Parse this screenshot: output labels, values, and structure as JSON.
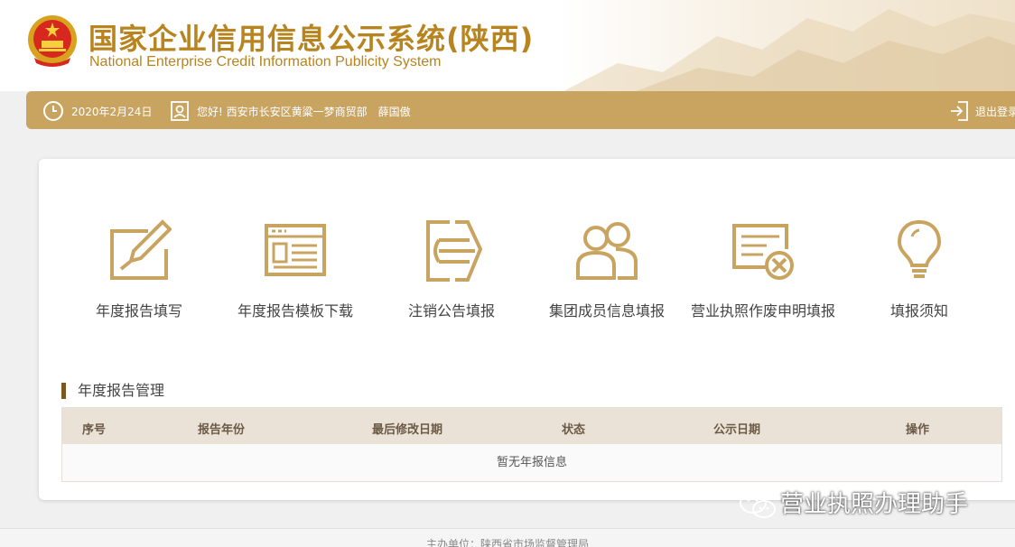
{
  "header": {
    "title_cn": "国家企业信用信息公示系统(陕西)",
    "title_en": "National Enterprise Credit Information Publicity System"
  },
  "infobar": {
    "date": "2020年2月24日",
    "greeting": "您好! 西安市长安区黄粱一梦商贸部　薛国傲",
    "logout_label": "退出登录"
  },
  "tiles": [
    {
      "label": "年度报告填写",
      "icon": "edit-form-icon"
    },
    {
      "label": "年度报告模板下载",
      "icon": "template-download-icon"
    },
    {
      "label": "注销公告填报",
      "icon": "cancel-notice-icon"
    },
    {
      "label": "集团成员信息填报",
      "icon": "group-members-icon"
    },
    {
      "label": "营业执照作废申明填报",
      "icon": "license-void-icon"
    },
    {
      "label": "填报须知",
      "icon": "lightbulb-icon"
    }
  ],
  "report_section": {
    "title": "年度报告管理",
    "columns": [
      "序号",
      "报告年份",
      "最后修改日期",
      "状态",
      "公示日期",
      "操作"
    ],
    "empty_text": "暂无年报信息"
  },
  "watermark": "营业执照办理助手",
  "footer": "主办单位：陕西省市场监督管理局",
  "colors": {
    "brand_gold": "#c9a460",
    "title_gold": "#b8841f",
    "table_header_bg": "#eae1d7"
  }
}
